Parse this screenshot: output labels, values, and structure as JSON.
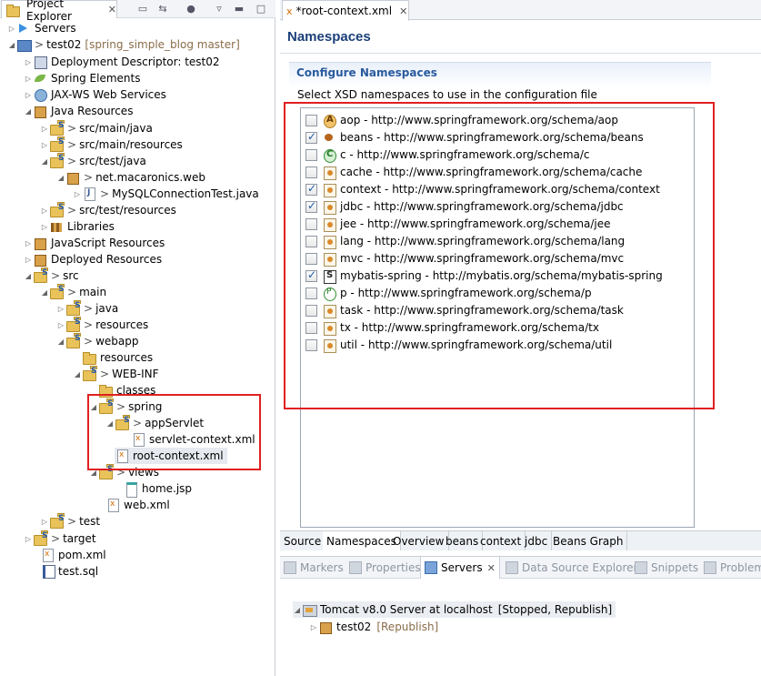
{
  "project_explorer": {
    "tab_label": "Project Explorer",
    "close_glyph": "✕",
    "tree": [
      {
        "label": "Servers",
        "icon": "servers-folder-icon"
      },
      {
        "label": "test02",
        "extra": "[spring_simple_blog master]",
        "prefix": ">",
        "icon": "project-icon"
      },
      {
        "label": "Deployment Descriptor: test02",
        "icon": "deployment-descriptor-icon"
      },
      {
        "label": "Spring Elements",
        "icon": "spring-leaf-icon"
      },
      {
        "label": "JAX-WS Web Services",
        "icon": "web-services-icon"
      },
      {
        "label": "Java Resources",
        "icon": "java-resources-icon"
      },
      {
        "label": "src/main/java",
        "prefix": ">",
        "icon": "source-folder-icon"
      },
      {
        "label": "src/main/resources",
        "prefix": ">",
        "icon": "source-folder-icon"
      },
      {
        "label": "src/test/java",
        "prefix": ">",
        "icon": "source-folder-icon"
      },
      {
        "label": "net.macaronics.web",
        "prefix": ">",
        "icon": "package-icon"
      },
      {
        "label": "MySQLConnectionTest.java",
        "prefix": ">",
        "icon": "java-file-icon"
      },
      {
        "label": "src/test/resources",
        "prefix": ">",
        "icon": "source-folder-icon"
      },
      {
        "label": "Libraries",
        "icon": "libraries-icon"
      },
      {
        "label": "JavaScript Resources",
        "icon": "javascript-resources-icon"
      },
      {
        "label": "Deployed Resources",
        "icon": "deployed-resources-icon"
      },
      {
        "label": "src",
        "prefix": ">",
        "icon": "folder-icon"
      },
      {
        "label": "main",
        "prefix": ">",
        "icon": "folder-icon"
      },
      {
        "label": "java",
        "prefix": ">",
        "icon": "folder-icon"
      },
      {
        "label": "resources",
        "prefix": ">",
        "icon": "folder-icon"
      },
      {
        "label": "webapp",
        "prefix": ">",
        "icon": "folder-icon"
      },
      {
        "label": "resources",
        "icon": "folder-icon"
      },
      {
        "label": "WEB-INF",
        "prefix": ">",
        "icon": "folder-icon"
      },
      {
        "label": "classes",
        "icon": "folder-icon"
      },
      {
        "label": "spring",
        "prefix": ">",
        "icon": "folder-icon"
      },
      {
        "label": "appServlet",
        "prefix": ">",
        "icon": "folder-icon"
      },
      {
        "label": "servlet-context.xml",
        "icon": "xml-file-icon"
      },
      {
        "label": "root-context.xml",
        "icon": "xml-file-icon"
      },
      {
        "label": "views",
        "prefix": ">",
        "icon": "folder-icon"
      },
      {
        "label": "home.jsp",
        "icon": "jsp-file-icon"
      },
      {
        "label": "web.xml",
        "icon": "xml-file-icon"
      },
      {
        "label": "test",
        "prefix": ">",
        "icon": "folder-icon"
      },
      {
        "label": "target",
        "prefix": ">",
        "icon": "folder-icon"
      },
      {
        "label": "pom.xml",
        "icon": "xml-file-icon"
      },
      {
        "label": "test.sql",
        "icon": "sql-file-icon"
      }
    ]
  },
  "editor": {
    "tab_label": "*root-context.xml",
    "tab_icon_glyph": "x",
    "close_glyph": "✕",
    "title": "Namespaces",
    "section_title": "Configure Namespaces",
    "section_desc": "Select XSD namespaces to use in the configuration file",
    "namespaces": [
      {
        "label": "aop - http://www.springframework.org/schema/aop",
        "checked": false,
        "icon": "aop-icon"
      },
      {
        "label": "beans - http://www.springframework.org/schema/beans",
        "checked": true,
        "icon": "beans-icon"
      },
      {
        "label": "c - http://www.springframework.org/schema/c",
        "checked": false,
        "icon": "c-namespace-icon"
      },
      {
        "label": "cache - http://www.springframework.org/schema/cache",
        "checked": false,
        "icon": "cache-icon"
      },
      {
        "label": "context - http://www.springframework.org/schema/context",
        "checked": true,
        "icon": "context-icon"
      },
      {
        "label": "jdbc - http://www.springframework.org/schema/jdbc",
        "checked": true,
        "icon": "jdbc-icon"
      },
      {
        "label": "jee - http://www.springframework.org/schema/jee",
        "checked": false,
        "icon": "jee-icon"
      },
      {
        "label": "lang - http://www.springframework.org/schema/lang",
        "checked": false,
        "icon": "lang-icon"
      },
      {
        "label": "mvc - http://www.springframework.org/schema/mvc",
        "checked": false,
        "icon": "mvc-icon"
      },
      {
        "label": "mybatis-spring - http://mybatis.org/schema/mybatis-spring",
        "checked": true,
        "icon": "mybatis-icon"
      },
      {
        "label": "p - http://www.springframework.org/schema/p",
        "checked": false,
        "icon": "p-namespace-icon"
      },
      {
        "label": "task - http://www.springframework.org/schema/task",
        "checked": false,
        "icon": "task-icon"
      },
      {
        "label": "tx - http://www.springframework.org/schema/tx",
        "checked": false,
        "icon": "tx-icon"
      },
      {
        "label": "util - http://www.springframework.org/schema/util",
        "checked": false,
        "icon": "util-icon"
      }
    ],
    "bottom_tabs": [
      "Source",
      "Namespaces",
      "Overview",
      "beans",
      "context",
      "jdbc",
      "Beans Graph"
    ],
    "active_bottom_tab": "Namespaces"
  },
  "servers_view": {
    "tabs": [
      "Markers",
      "Properties",
      "Servers",
      "Data Source Explorer",
      "Snippets",
      "Problem"
    ],
    "active_tab": "Servers",
    "close_glyph": "✕",
    "server": {
      "name": "Tomcat v8.0 Server at localhost",
      "status": "[Stopped, Republish]"
    },
    "module": {
      "name": "test02",
      "status": "[Republish]"
    }
  },
  "colors": {
    "highlight_box": "#e02020",
    "title": "#1b3f7a",
    "section_title": "#2a5b9e"
  }
}
